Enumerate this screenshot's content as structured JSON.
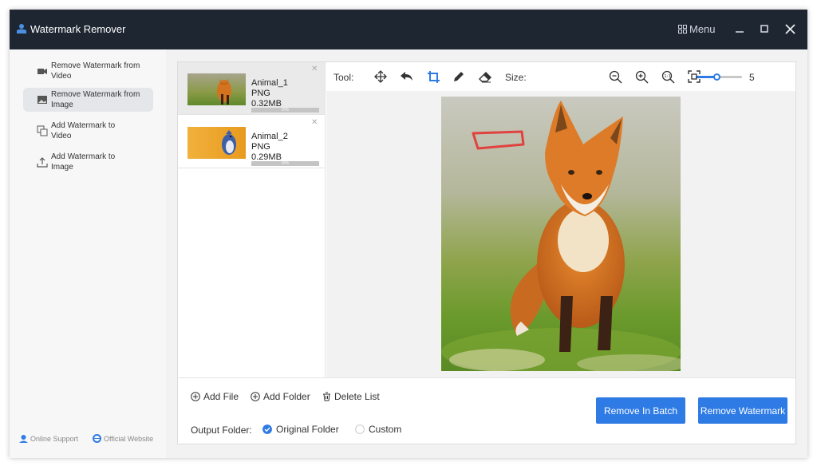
{
  "app": {
    "title": "Watermark Remover",
    "menu_label": "Menu"
  },
  "sidebar": {
    "items": [
      {
        "label": "Remove Watermark from Video",
        "icon": "video-remove-icon",
        "active": false
      },
      {
        "label": "Remove Watermark from Image",
        "icon": "image-remove-icon",
        "active": true
      },
      {
        "label": "Add Watermark to Video",
        "icon": "video-add-icon",
        "active": false
      },
      {
        "label": "Add Watermark to Image",
        "icon": "upload-icon",
        "active": false
      }
    ],
    "online_support": "Online Support",
    "official_website": "Official Website"
  },
  "files": [
    {
      "name": "Animal_1",
      "type": "PNG",
      "size": "0.32MB",
      "progress": "0%"
    },
    {
      "name": "Animal_2",
      "type": "PNG",
      "size": "0.29MB",
      "progress": "0%"
    }
  ],
  "toolbar": {
    "tool_label": "Tool:",
    "size_label": "Size:",
    "size_value": "5",
    "size_fraction": 0.45
  },
  "bottom": {
    "add_file": "Add File",
    "add_folder": "Add Folder",
    "delete_list": "Delete List",
    "output_folder_label": "Output Folder:",
    "original_folder": "Original Folder",
    "custom": "Custom",
    "remove_batch": "Remove In Batch",
    "remove_watermark": "Remove Watermark"
  },
  "colors": {
    "accent": "#2f7be5",
    "titlebar": "#1e2632",
    "mask": "#e0423f"
  }
}
